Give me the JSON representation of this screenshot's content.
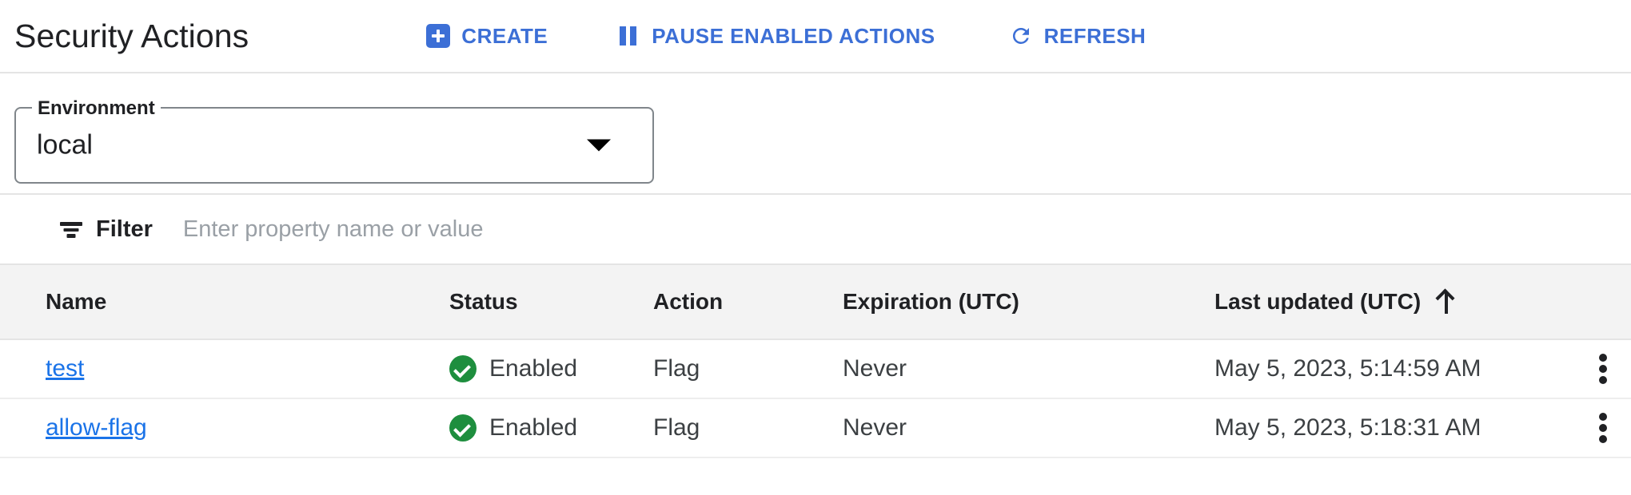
{
  "header": {
    "title": "Security Actions",
    "buttons": [
      {
        "label": "CREATE",
        "icon": "plus-box-icon"
      },
      {
        "label": "PAUSE ENABLED ACTIONS",
        "icon": "pause-icon"
      },
      {
        "label": "REFRESH",
        "icon": "refresh-icon"
      }
    ]
  },
  "environment": {
    "label": "Environment",
    "value": "local",
    "arrow_icon": "chevron-down-icon"
  },
  "filter": {
    "icon": "filter-icon",
    "label": "Filter",
    "placeholder": "Enter property name or value",
    "value": ""
  },
  "table": {
    "columns": [
      {
        "key": "name",
        "label": "Name"
      },
      {
        "key": "status",
        "label": "Status"
      },
      {
        "key": "action",
        "label": "Action"
      },
      {
        "key": "expiration",
        "label": "Expiration (UTC)"
      },
      {
        "key": "last_updated",
        "label": "Last updated (UTC)"
      }
    ],
    "sort": {
      "column": "last_updated",
      "direction": "asc",
      "icon": "arrow-up-icon"
    },
    "rows": [
      {
        "name": "test",
        "status": "Enabled",
        "status_icon": "check-circle-icon",
        "action": "Flag",
        "expiration": "Never",
        "last_updated": "May 5, 2023, 5:14:59 AM",
        "menu_icon": "more-vert-icon"
      },
      {
        "name": "allow-flag",
        "status": "Enabled",
        "status_icon": "check-circle-icon",
        "action": "Flag",
        "expiration": "Never",
        "last_updated": "May 5, 2023, 5:18:31 AM",
        "menu_icon": "more-vert-icon"
      }
    ]
  },
  "colors": {
    "accent_blue": "#3c6fd6",
    "link_blue": "#1a73e8",
    "status_green": "#1e8e3e",
    "header_row_bg": "#f3f3f3",
    "divider": "#e4e4e4"
  }
}
